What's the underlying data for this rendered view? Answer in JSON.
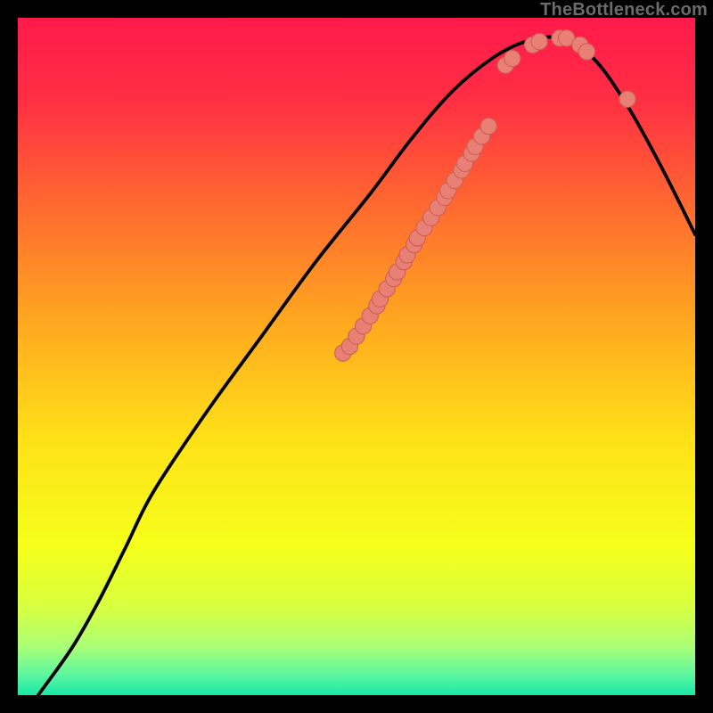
{
  "watermark": "TheBottleneck.com",
  "colors": {
    "curve": "#000000",
    "dot_fill": "#e98076",
    "dot_stroke": "#cf5f55"
  },
  "chart_data": {
    "type": "line",
    "title": "",
    "xlabel": "",
    "ylabel": "",
    "xlim": [
      0,
      100
    ],
    "ylim": [
      0,
      100
    ],
    "curve": [
      {
        "x": 3,
        "y": 0
      },
      {
        "x": 8,
        "y": 7
      },
      {
        "x": 12,
        "y": 14
      },
      {
        "x": 16,
        "y": 22
      },
      {
        "x": 20,
        "y": 30
      },
      {
        "x": 28,
        "y": 42
      },
      {
        "x": 36,
        "y": 53
      },
      {
        "x": 44,
        "y": 64
      },
      {
        "x": 52,
        "y": 74
      },
      {
        "x": 58,
        "y": 82
      },
      {
        "x": 64,
        "y": 89
      },
      {
        "x": 70,
        "y": 94
      },
      {
        "x": 75,
        "y": 96.5
      },
      {
        "x": 80,
        "y": 97
      },
      {
        "x": 85,
        "y": 94
      },
      {
        "x": 90,
        "y": 87
      },
      {
        "x": 95,
        "y": 78
      },
      {
        "x": 100,
        "y": 68
      }
    ],
    "points": [
      {
        "x": 48,
        "y": 50.5
      },
      {
        "x": 49,
        "y": 51.5
      },
      {
        "x": 50,
        "y": 53
      },
      {
        "x": 51,
        "y": 54.5
      },
      {
        "x": 52,
        "y": 56
      },
      {
        "x": 53,
        "y": 57.5
      },
      {
        "x": 53.5,
        "y": 58.5
      },
      {
        "x": 54.5,
        "y": 60
      },
      {
        "x": 55.5,
        "y": 61.5
      },
      {
        "x": 56,
        "y": 62.5
      },
      {
        "x": 57,
        "y": 64
      },
      {
        "x": 57.5,
        "y": 65
      },
      {
        "x": 58.5,
        "y": 66.5
      },
      {
        "x": 59,
        "y": 67.5
      },
      {
        "x": 60,
        "y": 69
      },
      {
        "x": 61,
        "y": 70.5
      },
      {
        "x": 62,
        "y": 72
      },
      {
        "x": 63,
        "y": 73.5
      },
      {
        "x": 63.5,
        "y": 74.5
      },
      {
        "x": 64.5,
        "y": 76
      },
      {
        "x": 65.5,
        "y": 77.5
      },
      {
        "x": 66,
        "y": 78.5
      },
      {
        "x": 67,
        "y": 80
      },
      {
        "x": 67.5,
        "y": 81
      },
      {
        "x": 68.5,
        "y": 82.5
      },
      {
        "x": 69.5,
        "y": 84
      },
      {
        "x": 72,
        "y": 93
      },
      {
        "x": 73,
        "y": 94
      },
      {
        "x": 76,
        "y": 96
      },
      {
        "x": 77,
        "y": 96.5
      },
      {
        "x": 80,
        "y": 97
      },
      {
        "x": 81,
        "y": 97
      },
      {
        "x": 83,
        "y": 96
      },
      {
        "x": 84,
        "y": 95
      },
      {
        "x": 90,
        "y": 88
      }
    ]
  }
}
